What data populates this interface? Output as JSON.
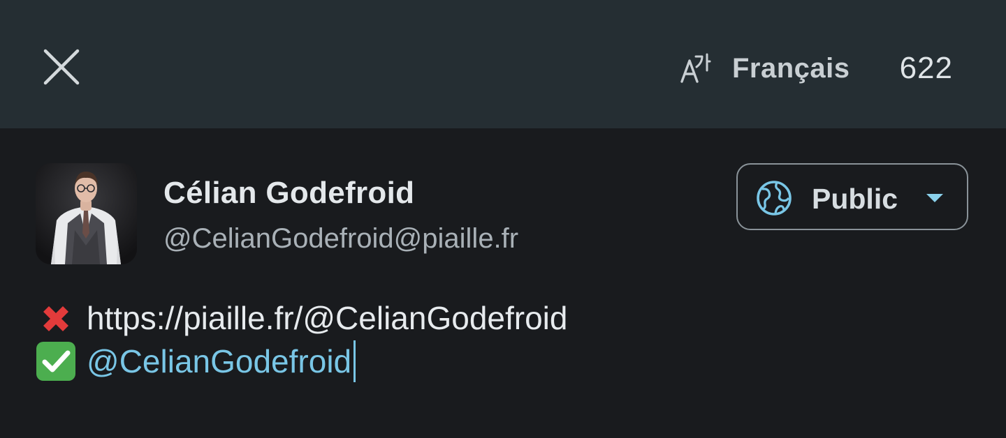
{
  "header": {
    "close_icon": "close-icon",
    "language_icon": "translate-icon",
    "language_label": "Français",
    "char_count": "622"
  },
  "account": {
    "display_name": "Célian Godefroid",
    "handle": "@CelianGodefroid@piaille.fr",
    "avatar": "profile-photo"
  },
  "visibility": {
    "icon": "globe-icon",
    "label": "Public",
    "caret_icon": "caret-down-icon"
  },
  "compose": {
    "line1_emoji": "cross-mark-emoji",
    "line1_text": "https://piaille.fr/@CelianGodefroid",
    "line2_emoji": "check-mark-emoji",
    "line2_mention": "@CelianGodefroid"
  },
  "colors": {
    "topbar_bg": "#252e33",
    "screen_bg": "#191b1e",
    "accent": "#79c6e6",
    "cross_red": "#e23b3b",
    "check_green": "#4cae4f"
  }
}
